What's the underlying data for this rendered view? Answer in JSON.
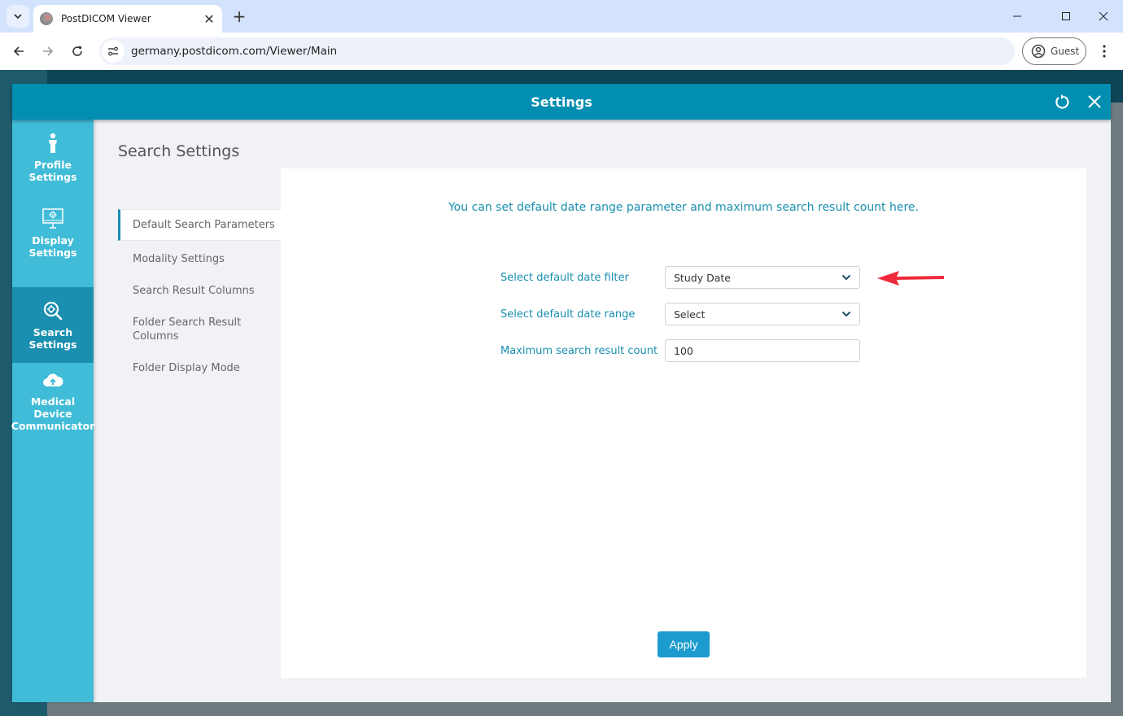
{
  "browser": {
    "tab_title": "PostDICOM Viewer",
    "url": "germany.postdicom.com/Viewer/Main",
    "profile_label": "Guest"
  },
  "modal": {
    "title": "Settings",
    "side_nav": [
      {
        "label_line1": "Profile",
        "label_line2": "Settings",
        "icon": "person-icon",
        "active": false
      },
      {
        "label_line1": "Display",
        "label_line2": "Settings",
        "icon": "monitor-gear-icon",
        "active": false
      },
      {
        "label_line1": "Search",
        "label_line2": "Settings",
        "icon": "search-gear-icon",
        "active": true
      },
      {
        "label_line1": "Medical Device",
        "label_line2": "Communicator",
        "icon": "cloud-upload-icon",
        "active": false
      }
    ],
    "section_title": "Search Settings",
    "sub_nav": [
      {
        "label": "Default Search Parameters",
        "active": true
      },
      {
        "label": "Modality Settings",
        "active": false
      },
      {
        "label": "Search Result Columns",
        "active": false
      },
      {
        "label": "Folder Search Result Columns",
        "active": false
      },
      {
        "label": "Folder Display Mode",
        "active": false
      }
    ],
    "panel": {
      "intro": "You can set default date range parameter and maximum search result count here.",
      "fields": {
        "date_filter": {
          "label": "Select default date filter",
          "value": "Study Date"
        },
        "date_range": {
          "label": "Select default date range",
          "value": "Select"
        },
        "max_count": {
          "label": "Maximum search result count",
          "value": "100"
        }
      },
      "apply_label": "Apply"
    }
  },
  "colors": {
    "accent": "#028eb1",
    "side_nav": "#40bcd8",
    "side_nav_active": "#1a8fb0",
    "annotation_arrow": "#ee2b3b"
  }
}
